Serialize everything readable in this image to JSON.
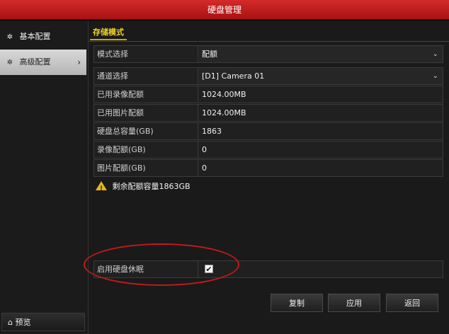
{
  "window": {
    "title": "硬盘管理"
  },
  "sidebar": {
    "items": [
      {
        "label": "基本配置",
        "icon": "gear-icon"
      },
      {
        "label": "高级配置",
        "icon": "gear-icon"
      }
    ],
    "preview_label": "预览"
  },
  "main": {
    "tab_label": "存储模式",
    "fields": {
      "mode": {
        "label": "模式选择",
        "value": "配额"
      },
      "channel": {
        "label": "通道选择",
        "value": "[D1] Camera 01"
      },
      "used_record": {
        "label": "已用录像配额",
        "value": "1024.00MB"
      },
      "used_image": {
        "label": "已用图片配额",
        "value": "1024.00MB"
      },
      "hdd_capacity": {
        "label": "硬盘总容量(GB)",
        "value": "1863"
      },
      "record_quota": {
        "label": "录像配额(GB)",
        "value": "0"
      },
      "image_quota": {
        "label": "图片配额(GB)",
        "value": "0"
      },
      "hdd_sleep": {
        "label": "启用硬盘休眠",
        "checked": true
      }
    },
    "warning": "剩余配额容量1863GB"
  },
  "buttons": {
    "copy": "复制",
    "apply": "应用",
    "back": "返回"
  },
  "colors": {
    "titlebar": "#c41e1e",
    "tab_accent": "#f2d027",
    "annotation_circle": "#c21a1a",
    "warning": "#e8b316"
  }
}
